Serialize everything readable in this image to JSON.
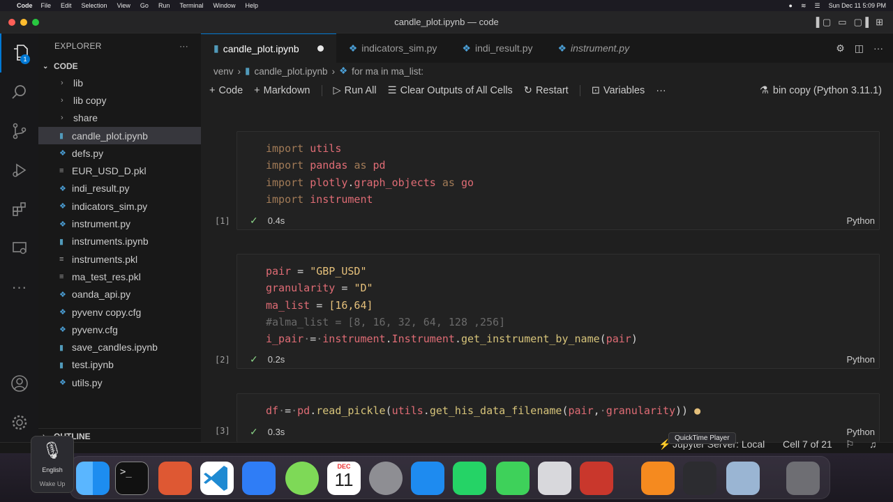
{
  "menubar": {
    "app": "Code",
    "items": [
      "File",
      "Edit",
      "Selection",
      "View",
      "Go",
      "Run",
      "Terminal",
      "Window",
      "Help"
    ],
    "datetime": "Sun Dec 11  5:09 PM"
  },
  "window": {
    "title": "candle_plot.ipynb — code"
  },
  "activity": {
    "explorer_badge": "1"
  },
  "sidebar": {
    "header": "EXPLORER",
    "section": "CODE",
    "items": [
      {
        "label": "lib",
        "type": "folder"
      },
      {
        "label": "lib copy",
        "type": "folder"
      },
      {
        "label": "share",
        "type": "folder"
      },
      {
        "label": "candle_plot.ipynb",
        "type": "nb"
      },
      {
        "label": "defs.py",
        "type": "py"
      },
      {
        "label": "EUR_USD_D.pkl",
        "type": "txt"
      },
      {
        "label": "indi_result.py",
        "type": "py"
      },
      {
        "label": "indicators_sim.py",
        "type": "py"
      },
      {
        "label": "instrument.py",
        "type": "py"
      },
      {
        "label": "instruments.ipynb",
        "type": "nb"
      },
      {
        "label": "instruments.pkl",
        "type": "txt"
      },
      {
        "label": "ma_test_res.pkl",
        "type": "txt"
      },
      {
        "label": "oanda_api.py",
        "type": "py"
      },
      {
        "label": "pyvenv copy.cfg",
        "type": "py"
      },
      {
        "label": "pyvenv.cfg",
        "type": "py"
      },
      {
        "label": "save_candles.ipynb",
        "type": "nb"
      },
      {
        "label": "test.ipynb",
        "type": "nb"
      },
      {
        "label": "utils.py",
        "type": "py"
      }
    ],
    "outline": "OUTLINE"
  },
  "tabs": [
    {
      "label": "candle_plot.ipynb"
    },
    {
      "label": "indicators_sim.py"
    },
    {
      "label": "indi_result.py"
    },
    {
      "label": "instrument.py"
    }
  ],
  "breadcrumb": [
    "venv",
    "candle_plot.ipynb",
    "for ma in ma_list:"
  ],
  "toolbar": {
    "code": "Code",
    "markdown": "Markdown",
    "run_all": "Run All",
    "clear": "Clear Outputs of All Cells",
    "restart": "Restart",
    "variables": "Variables",
    "kernel": "bin copy (Python 3.11.1)"
  },
  "cells": [
    {
      "exec": "[1]",
      "time": "0.4s",
      "lang": "Python"
    },
    {
      "exec": "[2]",
      "time": "0.2s",
      "lang": "Python"
    },
    {
      "exec": "[3]",
      "time": "0.3s",
      "lang": "Python"
    }
  ],
  "statusbar": {
    "server": "Jupyter Server: Local",
    "cell": "Cell 7 of 21"
  },
  "tooltip": "QuickTime Player",
  "dictation": {
    "language": "English",
    "wake": "Wake Up"
  },
  "dock": {
    "calendar_month": "DEC",
    "calendar_day": "11"
  }
}
